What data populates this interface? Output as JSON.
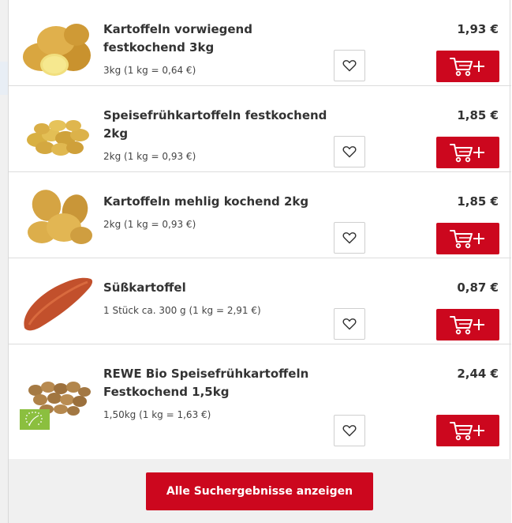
{
  "products": [
    {
      "title": "Kartoffeln vorwiegend festkochend 3kg",
      "unit_price": "3kg (1 kg = 0,64 €)",
      "price": "1,93 €",
      "image": "potatoes-large-with-cut-half"
    },
    {
      "title": "Speisefrühkartoffeln festkochend 2kg",
      "unit_price": "2kg (1 kg = 0,93 €)",
      "price": "1,85 €",
      "image": "small-potatoes-pile"
    },
    {
      "title": "Kartoffeln mehlig kochend 2kg",
      "unit_price": "2kg (1 kg = 0,93 €)",
      "price": "1,85 €",
      "image": "floury-potatoes"
    },
    {
      "title": "Süßkartoffel",
      "unit_price": "1 Stück ca. 300 g (1 kg = 2,91 €)",
      "price": "0,87 €",
      "image": "sweet-potato"
    },
    {
      "title": "REWE Bio Speisefrühkartoffeln Festkochend 1,5kg",
      "unit_price": "1,50kg (1 kg = 1,63 €)",
      "price": "2,44 €",
      "image": "bio-baby-potatoes",
      "badge": "eu-organic-leaf-badge"
    }
  ],
  "icons": {
    "favorite": "heart-outline-icon",
    "add_to_cart": "cart-plus-icon"
  },
  "footer": {
    "show_all_label": "Alle Suchergebnisse anzeigen"
  },
  "colors": {
    "accent": "#cc071e",
    "text": "#333333",
    "divider": "#dcdcdc",
    "footer_bg": "#f0f0f0"
  }
}
